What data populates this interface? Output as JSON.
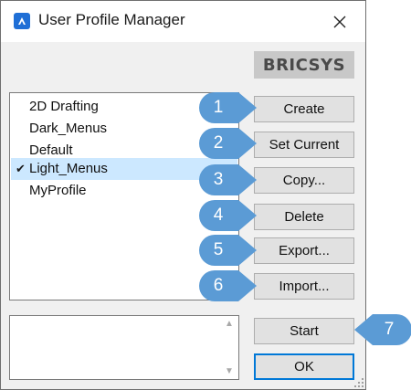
{
  "window": {
    "title": "User Profile Manager",
    "icon": "bricscad-app-icon"
  },
  "logo": {
    "text": "BRICSYS"
  },
  "profiles": [
    {
      "label": "2D Drafting",
      "current": false
    },
    {
      "label": "Dark_Menus",
      "current": false
    },
    {
      "label": "Default",
      "current": false
    },
    {
      "label": "Light_Menus",
      "current": true
    },
    {
      "label": "MyProfile",
      "current": false
    }
  ],
  "current_marker": "✔",
  "buttons": {
    "create": "Create",
    "set_current": "Set Current",
    "copy": "Copy...",
    "delete": "Delete",
    "export": "Export...",
    "import": "Import...",
    "start": "Start",
    "ok": "OK"
  },
  "callouts": [
    "1",
    "2",
    "3",
    "4",
    "5",
    "6",
    "7"
  ],
  "colors": {
    "callout": "#5b9bd5",
    "selection": "#cce8ff",
    "accent": "#0078d7"
  }
}
